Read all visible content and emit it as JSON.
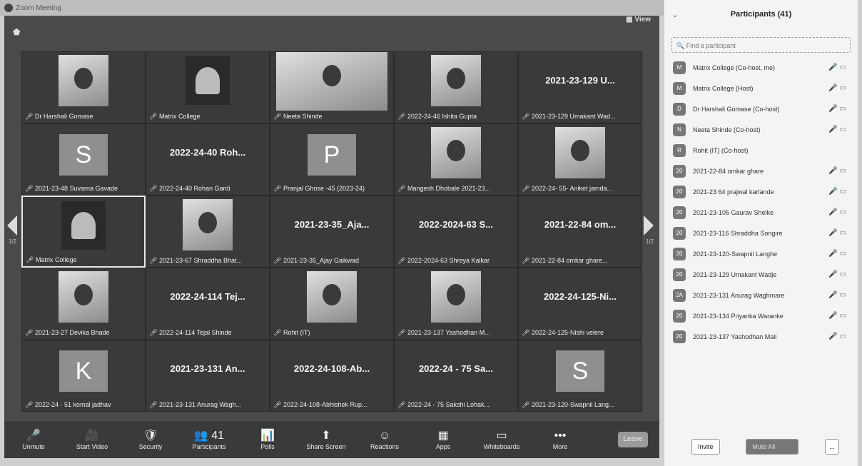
{
  "window": {
    "title": "Zoom Meeting",
    "view_label": "View"
  },
  "pagination": {
    "left": "1/2",
    "right": "1/2"
  },
  "tiles": [
    {
      "kind": "photo",
      "big": "",
      "name": "Dr Harshali Gomase"
    },
    {
      "kind": "logo",
      "big": "",
      "name": "Matrix College"
    },
    {
      "kind": "photo-wide",
      "big": "",
      "name": "Neeta Shinde"
    },
    {
      "kind": "photo",
      "big": "",
      "name": "2022-24-46 Ishita Gupta"
    },
    {
      "kind": "text",
      "big": "2021-23-129 U...",
      "name": "2021-23-129 Umakant Wad..."
    },
    {
      "kind": "letter",
      "big": "S",
      "name": "2021-23-48 Suvarna Gavade"
    },
    {
      "kind": "text",
      "big": "2022-24-40 Roh...",
      "name": "2022-24-40 Rohan Gardi"
    },
    {
      "kind": "letter",
      "big": "P",
      "name": "Pranjal Ghose -45 (2023-24)"
    },
    {
      "kind": "photo",
      "big": "",
      "name": "Mangesh Dhobale 2021-23..."
    },
    {
      "kind": "photo",
      "big": "",
      "name": "2022-24- 55- Aniket jamda..."
    },
    {
      "kind": "logo",
      "big": "",
      "name": "Matrix College",
      "active": true
    },
    {
      "kind": "photo",
      "big": "",
      "name": "2021-23-67 Shraddha Bhat..."
    },
    {
      "kind": "text",
      "big": "2021-23-35_Aja...",
      "name": "2021-23-35_Ajay Gaikwad"
    },
    {
      "kind": "text",
      "big": "2022-2024-63 S...",
      "name": "2022-2024-63 Shreya Kalkar"
    },
    {
      "kind": "text",
      "big": "2021-22-84 om...",
      "name": "2021-22-84 omkar ghare..."
    },
    {
      "kind": "photo",
      "big": "",
      "name": "2021-23-27 Devika Bhade"
    },
    {
      "kind": "text",
      "big": "2022-24-114 Tej...",
      "name": "2022-24-114 Tejal Shinde"
    },
    {
      "kind": "photo",
      "big": "",
      "name": "Rohit (IT)"
    },
    {
      "kind": "photo",
      "big": "",
      "name": "2021-23-137 Yashodhan M..."
    },
    {
      "kind": "text",
      "big": "2022-24-125-Ni...",
      "name": "2022-24-125-Nishi velere"
    },
    {
      "kind": "letter",
      "big": "K",
      "name": "2022-24 - 51 komal jadhav"
    },
    {
      "kind": "text",
      "big": "2021-23-131 An...",
      "name": "2021-23-131 Anurag Wagh..."
    },
    {
      "kind": "text",
      "big": "2022-24-108-Ab...",
      "name": "2022-24-108-Abhishek Rup..."
    },
    {
      "kind": "text",
      "big": "2022-24  - 75 Sa...",
      "name": "2022-24 - 75 Sakshi Lohak..."
    },
    {
      "kind": "letter",
      "big": "S",
      "name": "2021-23-120-Swapnil Lang..."
    }
  ],
  "toolbar": [
    {
      "icon": "🎤",
      "label": "Unmute",
      "name": "unmute"
    },
    {
      "icon": "🎥",
      "label": "Start Video",
      "name": "start-video"
    },
    {
      "icon": "🛡",
      "label": "Security",
      "name": "security"
    },
    {
      "icon": "👥 41",
      "label": "Participants",
      "name": "participants"
    },
    {
      "icon": "📊",
      "label": "Polls",
      "name": "polls"
    },
    {
      "icon": "⬆",
      "label": "Share Screen",
      "name": "share-screen"
    },
    {
      "icon": "☺",
      "label": "Reactions",
      "name": "reactions"
    },
    {
      "icon": "▦",
      "label": "Apps",
      "name": "apps"
    },
    {
      "icon": "▭",
      "label": "Whiteboards",
      "name": "whiteboards"
    },
    {
      "icon": "•••",
      "label": "More",
      "name": "more"
    }
  ],
  "leave_label": "Leave",
  "panel": {
    "title": "Participants (41)",
    "search_placeholder": "Find a participant",
    "participants": [
      {
        "av": "M",
        "name": "Matrix College (Co-host, me)",
        "icons": "🎤 ▭"
      },
      {
        "av": "M",
        "name": "Matrix College (Host)",
        "icons": "🎤 ▭"
      },
      {
        "av": "D",
        "name": "Dr Harshali Gomase (Co-host)",
        "icons": "🎤 ▭"
      },
      {
        "av": "N",
        "name": "Neeta Shinde (Co-host)",
        "icons": "🎤 ▭"
      },
      {
        "av": "R",
        "name": "Rohit (IT) (Co-host)",
        "icons": ""
      },
      {
        "av": "20",
        "name": "2021-22-84 omkar ghare",
        "icons": "🎤 ▭"
      },
      {
        "av": "20",
        "name": "2021-23 64 prajwal karlande",
        "icons": "🎤 ▭"
      },
      {
        "av": "20",
        "name": "2021-23-105 Gaurav Shelke",
        "icons": "🎤 ▭"
      },
      {
        "av": "20",
        "name": "2021-23-116 Shraddha Songire",
        "icons": "🎤 ▭"
      },
      {
        "av": "20",
        "name": "2021-23-120-Swapnil Langhe",
        "icons": "🎤 ▭"
      },
      {
        "av": "20",
        "name": "2021-23-129 Umakant Wadje",
        "icons": "🎤 ▭"
      },
      {
        "av": "2A",
        "name": "2021-23-131 Anurag Waghmare",
        "icons": "🎤 ▭"
      },
      {
        "av": "20",
        "name": "2021-23-134 Priyanka Waranke",
        "icons": "🎤 ▭"
      },
      {
        "av": "20",
        "name": "2021-23-137 Yashodhan Mali",
        "icons": "🎤 ▭"
      }
    ],
    "invite_label": "Invite",
    "mute_all_label": "Mute All",
    "more_label": "..."
  }
}
